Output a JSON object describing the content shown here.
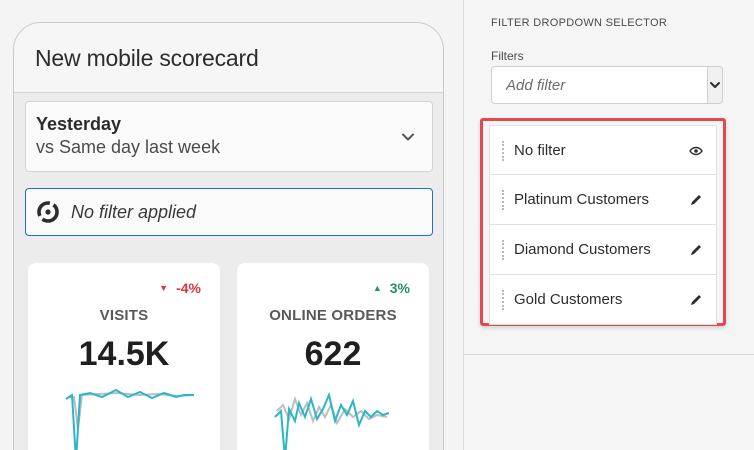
{
  "phone": {
    "title": "New mobile scorecard",
    "date_range": {
      "main": "Yesterday",
      "comparison": "vs Same day last week"
    },
    "filter_status": "No filter applied",
    "metrics": [
      {
        "label": "VISITS",
        "value": "14.5K",
        "change": "-4%",
        "direction": "down"
      },
      {
        "label": "ONLINE ORDERS",
        "value": "622",
        "change": "3%",
        "direction": "up"
      }
    ]
  },
  "panel": {
    "heading": "FILTER DROPDOWN SELECTOR",
    "field_label": "Filters",
    "placeholder": "Add filter",
    "filters": [
      {
        "label": "No filter",
        "icon": "eye-icon"
      },
      {
        "label": "Platinum Customers",
        "icon": "pencil-icon"
      },
      {
        "label": "Diamond Customers",
        "icon": "pencil-icon"
      },
      {
        "label": "Gold Customers",
        "icon": "pencil-icon"
      }
    ]
  },
  "colors": {
    "accent_blue": "#1f6ec7",
    "highlight_red": "#e34850",
    "negative": "#d7373f",
    "positive": "#268e6c",
    "spark_primary": "#2cb5c7",
    "spark_secondary": "#bdbdbd"
  }
}
